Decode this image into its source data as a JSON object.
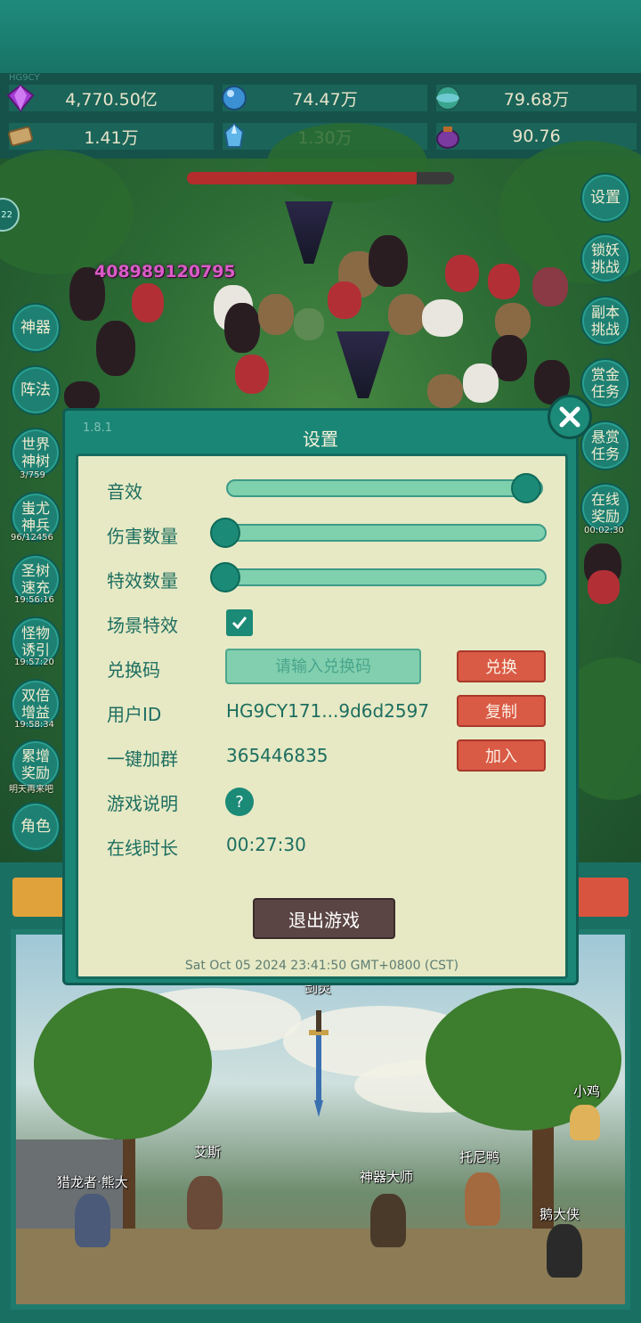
{
  "header": {
    "user_tag": "HG9CY"
  },
  "resources": [
    {
      "icon": "purple-gem-icon",
      "value": "4,770.50亿"
    },
    {
      "icon": "blue-crystal-orb-icon",
      "value": "74.47万"
    },
    {
      "icon": "teal-orb-icon",
      "value": "79.68万"
    },
    {
      "icon": "scroll-icon",
      "value": "1.41万"
    },
    {
      "icon": "ice-crystal-icon",
      "value": "1.30万"
    },
    {
      "icon": "purple-pouch-icon",
      "value": "90.76"
    }
  ],
  "battle": {
    "damage_text": "408989120795",
    "boss_hp_fraction": 0.86,
    "level_badge": "22"
  },
  "left_menu": [
    {
      "label": "神器",
      "sub": ""
    },
    {
      "label": "阵法",
      "sub": ""
    },
    {
      "label": "世界神树",
      "sub": "3/759"
    },
    {
      "label": "蚩尤神兵",
      "sub": "96/12456"
    },
    {
      "label": "圣树速充",
      "sub": "19:56:16"
    },
    {
      "label": "怪物诱引",
      "sub": "19:57:20"
    },
    {
      "label": "双倍增益",
      "sub": "19:58:34"
    },
    {
      "label": "累增奖励",
      "sub": "明天再来吧"
    },
    {
      "label": "角色",
      "sub": ""
    }
  ],
  "right_menu": [
    {
      "label": "设置",
      "sub": ""
    },
    {
      "label": "锁妖挑战",
      "sub": ""
    },
    {
      "label": "副本挑战",
      "sub": ""
    },
    {
      "label": "赏金任务",
      "sub": ""
    },
    {
      "label": "悬赏任务",
      "sub": ""
    },
    {
      "label": "在线奖励",
      "sub": "00:02:30"
    }
  ],
  "scene": {
    "npcs": [
      "剑灵",
      "小鸡",
      "艾斯",
      "托尼鸭",
      "猎龙者·熊大",
      "神器大师",
      "鹅大侠"
    ]
  },
  "settings": {
    "version": "1.8.1",
    "title": "设置",
    "sound_label": "音效",
    "sound_level": 1.0,
    "damage_label": "伤害数量",
    "damage_level": 0.0,
    "effects_label": "特效数量",
    "effects_level": 0.0,
    "scene_fx_label": "场景特效",
    "scene_fx_checked": true,
    "code_label": "兑换码",
    "code_placeholder": "请输入兑换码",
    "code_value": "",
    "redeem_button": "兑换",
    "userid_label": "用户ID",
    "userid_value": "HG9CY171...9d6d2597",
    "copy_button": "复制",
    "group_label": "一键加群",
    "group_value": "365446835",
    "join_button": "加入",
    "guide_label": "游戏说明",
    "guide_icon": "?",
    "online_label": "在线时长",
    "online_value": "00:27:30",
    "exit_button": "退出游戏",
    "datetime": "Sat Oct 05 2024 23:41:50 GMT+0800 (CST)"
  },
  "colors": {
    "accent": "#1b8a76",
    "panel": "#e6e9c4",
    "danger": "#d95a45",
    "text": "#1d6e60"
  }
}
